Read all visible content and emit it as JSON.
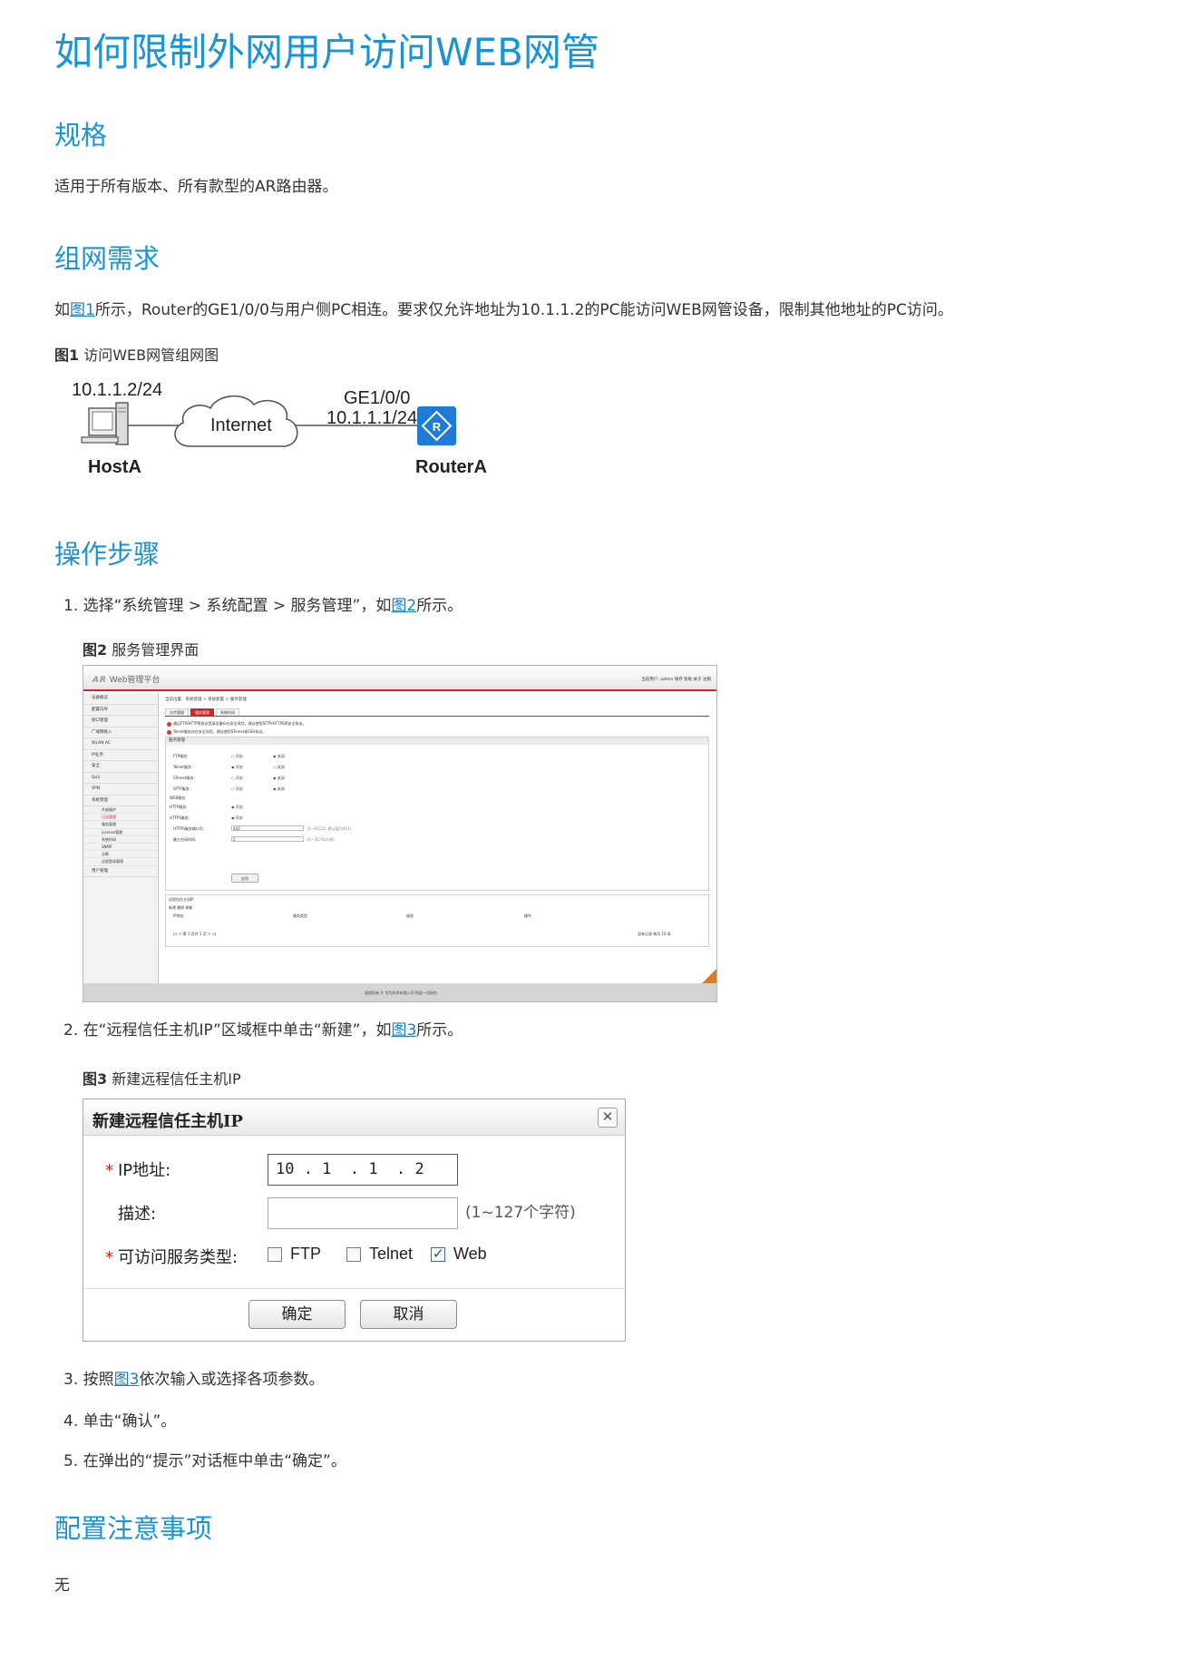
{
  "title": "如何限制外网用户访问WEB网管",
  "sections": {
    "spec": {
      "heading": "规格",
      "text": "适用于所有版本、所有款型的AR路由器。"
    },
    "req": {
      "heading": "组网需求",
      "text_pre": "如",
      "link": "图1",
      "text_post": "所示，Router的GE1/0/0与用户侧PC相连。要求仅允许地址为10.1.1.2的PC能访问WEB网管设备，限制其他地址的PC访问。",
      "fig_label": "图1",
      "fig_caption": "访问WEB网管组网图"
    },
    "steps": {
      "heading": "操作步骤",
      "step1": {
        "num": "1.",
        "pre": "选择“系统管理 > 系统配置 > 服务管理”，如",
        "link": "图2",
        "post": "所示。"
      },
      "fig2_label": "图2",
      "fig2_caption": "服务管理界面",
      "step2": {
        "num": "2.",
        "pre": "在“远程信任主机IP”区域框中单击“新建”，如",
        "link": "图3",
        "post": "所示。"
      },
      "fig3_label": "图3",
      "fig3_caption": "新建远程信任主机IP",
      "step3": {
        "num": "3.",
        "pre": "按照",
        "link": "图3",
        "post": "依次输入或选择各项参数。"
      },
      "step4": {
        "num": "4.",
        "text": "单击“确认”。"
      },
      "step5": {
        "num": "5.",
        "text": "在弹出的“提示”对话框中单击“确定”。"
      }
    },
    "notes": {
      "heading": "配置注意事项",
      "text": "无"
    }
  },
  "diagram": {
    "host_ip": "10.1.1.2/24",
    "host_name": "HostA",
    "cloud_label": "Internet",
    "port": "GE1/0/0",
    "router_ip": "10.1.1.1/24",
    "router_name": "RouterA",
    "router_color": "#1e7bd6"
  },
  "fig2": {
    "logo": "AR",
    "app_title": "Web管理平台",
    "top_right": "当前用户: admin   保存   帮助   关于   注销",
    "sidebar": [
      "设备概览",
      "配置向导",
      "接口管理",
      "广域网接入",
      "WLAN AC",
      "IP业务",
      "安全",
      "QoS",
      "VPN",
      "系统管理",
      "用户管理"
    ],
    "sidebar_sub": [
      "升级维护",
      "日志管理",
      "服务管理",
      "License管理",
      "系统时间",
      "SNMP",
      "诊断",
      "远程登录管理"
    ],
    "breadcrumb": "当前位置：系统管理 > 系统配置 > 服务管理",
    "tabs": [
      "文件管理",
      "服务管理",
      "系统时间"
    ],
    "warn1": "通过FTP/HTTP等协议登录设备存在安全风险，建议使用SFTP/HTTPS等安全协议。",
    "warn2": "Telnet服务存在安全风险，建议使用STelnet或SSH协议。",
    "box_title": "服务管理",
    "rows": [
      {
        "label": "FTP服务:",
        "a": "开启",
        "b": "关闭"
      },
      {
        "label": "Telnet服务:",
        "a": "开启",
        "b": "关闭"
      },
      {
        "label": "STelnet服务:",
        "a": "开启",
        "b": "关闭"
      },
      {
        "label": "SFTP服务:",
        "a": "开启",
        "b": "关闭"
      }
    ],
    "web_group": "WEB服务",
    "http_label": "HTTP服务:",
    "https_label": "HTTPS服务:",
    "on_label": "开启",
    "port_label": "HTTPS服务端口号:",
    "port_value": "443",
    "port_hint": "(1~65535, 默认值为443)",
    "timeout_label": "最大空闲时间:",
    "timeout_value": "5",
    "timeout_hint": "(1~35791分钟)",
    "apply": "应用",
    "trust_title": "远程信任主机IP",
    "toolbar": "新建  删除  刷新",
    "cols": [
      "IP地址",
      "服务类型",
      "描述",
      "操作"
    ],
    "pager": "|<  <  第 1  页共 1 页  >  >|",
    "pager_r": "没有记录  每页 10 条",
    "footer": "版权所有 © 华为技术有限公司 保留一切权利"
  },
  "fig3": {
    "title": "新建远程信任主机IP",
    "ip_label": "IP地址:",
    "ip_value": "10 . 1  . 1  . 2",
    "desc_label": "描述:",
    "desc_value": "",
    "desc_hint": "(1~127个字符)",
    "svc_label": "可访问服务类型:",
    "svc": [
      {
        "label": "FTP",
        "checked": false
      },
      {
        "label": "Telnet",
        "checked": false
      },
      {
        "label": "Web",
        "checked": true
      }
    ],
    "ok": "确定",
    "cancel": "取消",
    "required_mark": "*"
  }
}
